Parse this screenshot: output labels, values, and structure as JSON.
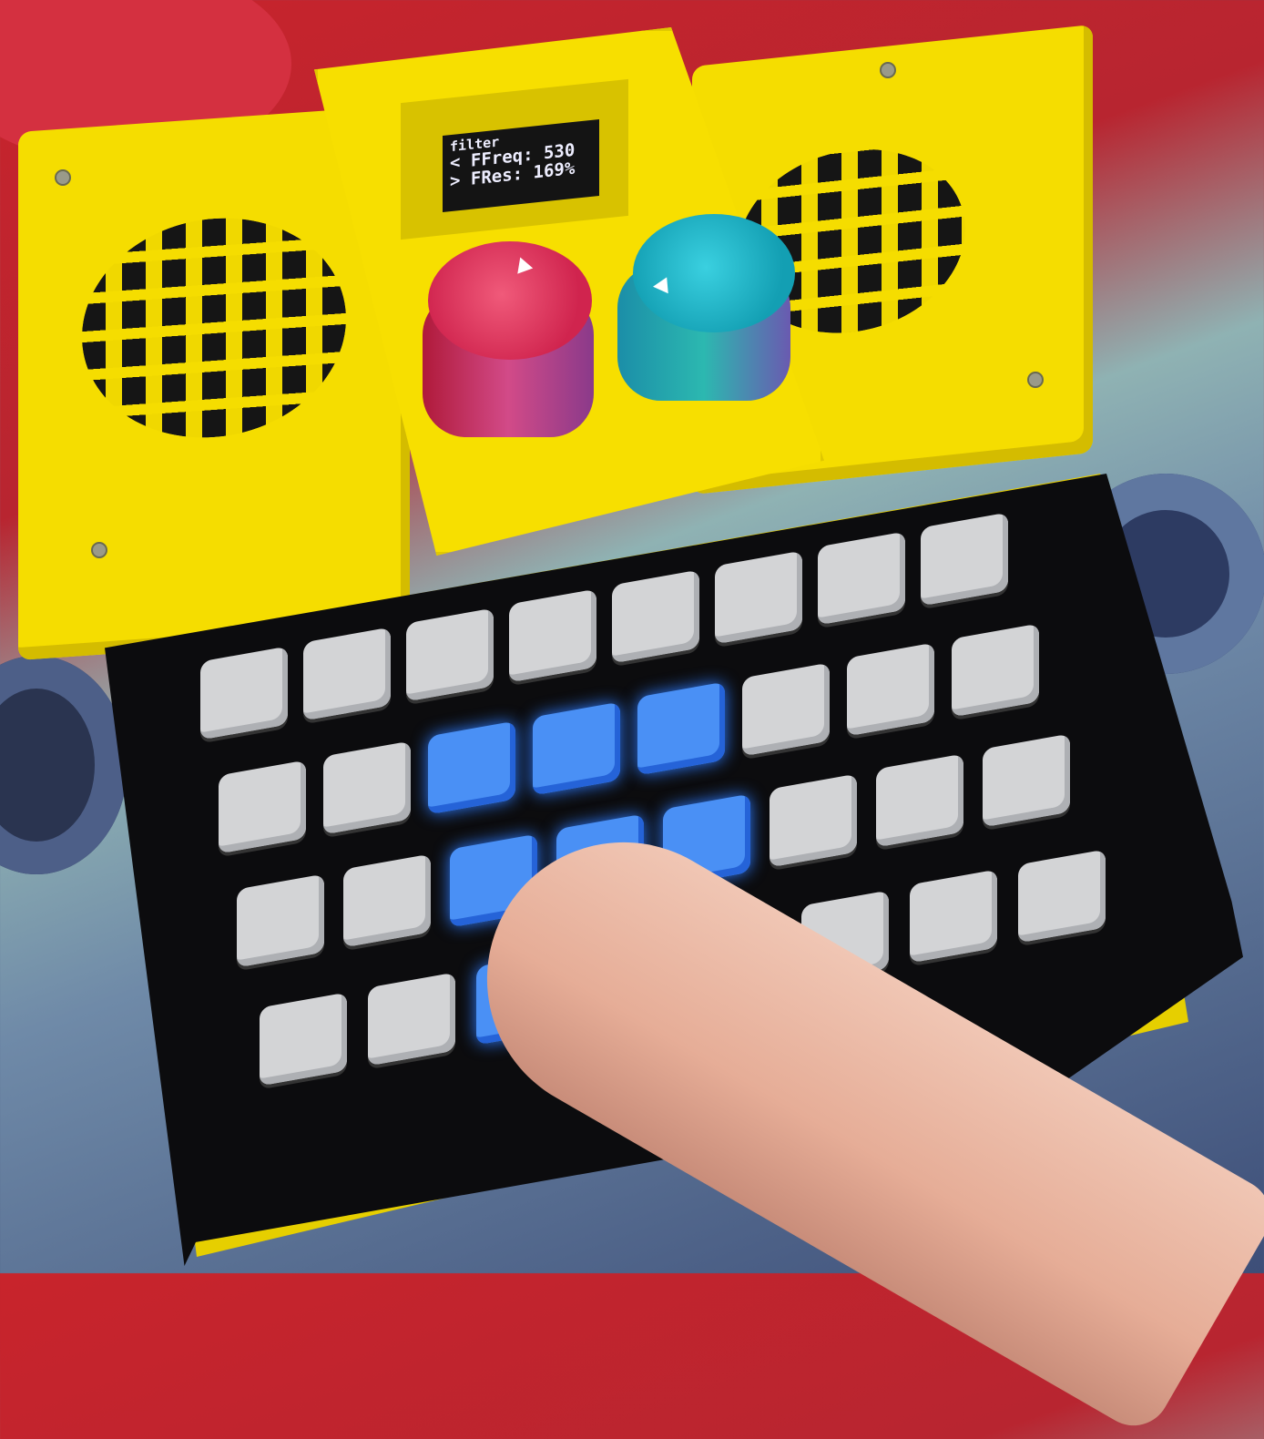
{
  "device": {
    "display": {
      "title": "filter",
      "line1": "< FFreq: 530",
      "line2": "> FRes: 169%"
    },
    "knobs": [
      {
        "name": "left-knob",
        "color": "#d82a5a"
      },
      {
        "name": "right-knob",
        "color": "#19a8b8"
      }
    ],
    "enclosure_color": "#f5dd00",
    "keypad": {
      "rows": 4,
      "cols": 8,
      "lit_color": "#4a90f5",
      "unlit_color": "#d3d4d6",
      "lit_keys": [
        [
          1,
          2
        ],
        [
          1,
          3
        ],
        [
          1,
          4
        ],
        [
          2,
          2
        ],
        [
          2,
          3
        ],
        [
          2,
          4
        ],
        [
          3,
          2
        ],
        [
          3,
          3
        ]
      ]
    }
  }
}
